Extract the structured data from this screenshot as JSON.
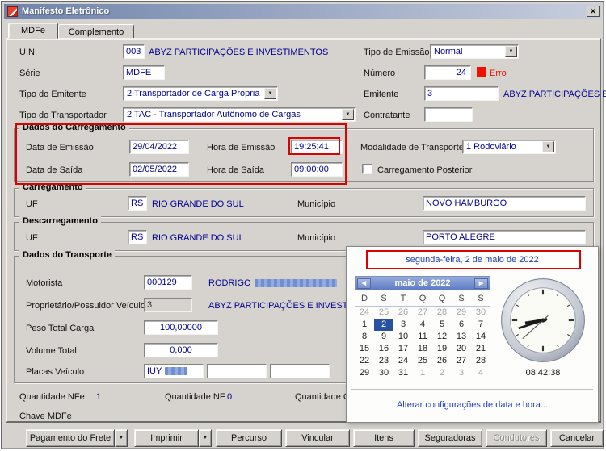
{
  "window": {
    "title": "Manifesto Eletrônico"
  },
  "glyphs": {
    "close": "✕",
    "dropdown": "▼",
    "prev": "◀",
    "next": "▶"
  },
  "tabs": {
    "mdfe": "MDFe",
    "complemento": "Complemento"
  },
  "form": {
    "un_label": "U.N.",
    "un_code": "003",
    "un_name": "ABYZ PARTICIPAÇÕES E INVESTIMENTOS",
    "tipo_emissao_label": "Tipo de Emissão",
    "tipo_emissao_value": "Normal",
    "serie_label": "Série",
    "serie_value": "MDFE",
    "numero_label": "Número",
    "numero_value": "24",
    "erro_label": "Erro",
    "tipo_emitente_label": "Tipo do Emitente",
    "tipo_emitente_value": "2 Transportador de Carga Própria",
    "emitente_label": "Emitente",
    "emitente_code": "3",
    "emitente_name": "ABYZ PARTICIPAÇÕES E INVEST",
    "tipo_transportador_label": "Tipo do Transportador",
    "tipo_transportador_value": "2 TAC - Transportador Autônomo de Cargas",
    "contratante_label": "Contratante",
    "contratante_value": ""
  },
  "dados_carregamento": {
    "title": "Dados do Carregamento",
    "data_emissao_label": "Data de Emissão",
    "data_emissao": "29/04/2022",
    "hora_emissao_label": "Hora de Emissão",
    "hora_emissao": "19:25:41",
    "modalidade_label": "Modalidade de Transporte",
    "modalidade": "1 Rodoviário",
    "data_saida_label": "Data de Saída",
    "data_saida": "02/05/2022",
    "hora_saida_label": "Hora de Saída",
    "hora_saida": "09:00:00",
    "carregamento_posterior_label": "Carregamento Posterior"
  },
  "carregamento": {
    "title": "Carregamento",
    "uf_label": "UF",
    "uf": "RS",
    "uf_nome": "RIO GRANDE DO SUL",
    "municipio_label": "Município",
    "municipio": "NOVO HAMBURGO"
  },
  "descarregamento": {
    "title": "Descarregamento",
    "uf_label": "UF",
    "uf": "RS",
    "uf_nome": "RIO GRANDE DO SUL",
    "municipio_label": "Município",
    "municipio": "PORTO ALEGRE"
  },
  "transporte": {
    "title": "Dados do Transporte",
    "motorista_label": "Motorista",
    "motorista_code": "000129",
    "motorista_nome": "RODRIGO",
    "proprietario_label": "Proprietário/Possuidor Veículo",
    "proprietario_code": "3",
    "proprietario_nome": "ABYZ PARTICIPAÇÕES E INVESTIMENTO",
    "peso_label": "Peso Total Carga",
    "peso": "100,00000",
    "volume_label": "Volume Total",
    "volume": "0,000",
    "placas_label": "Placas Veículo",
    "placa1_prefix": "IUY"
  },
  "totais": {
    "qtd_nfe_label": "Quantidade NFe",
    "qtd_nfe": "1",
    "qtd_nf_label": "Quantidade NF",
    "qtd_nf": "0",
    "qtd_c_label": "Quantidade C",
    "chave_label": "Chave MDFe"
  },
  "datetime_popup": {
    "header": "segunda-feira, 2 de maio de 2022",
    "month_title": "maio de 2022",
    "dow": [
      "D",
      "S",
      "T",
      "Q",
      "Q",
      "S",
      "S"
    ],
    "weeks": [
      [
        {
          "d": 24,
          "dim": true
        },
        {
          "d": 25,
          "dim": true
        },
        {
          "d": 26,
          "dim": true
        },
        {
          "d": 27,
          "dim": true
        },
        {
          "d": 28,
          "dim": true
        },
        {
          "d": 29,
          "dim": true
        },
        {
          "d": 30,
          "dim": true
        }
      ],
      [
        {
          "d": 1
        },
        {
          "d": 2,
          "sel": true
        },
        {
          "d": 3
        },
        {
          "d": 4
        },
        {
          "d": 5
        },
        {
          "d": 6
        },
        {
          "d": 7
        }
      ],
      [
        {
          "d": 8
        },
        {
          "d": 9
        },
        {
          "d": 10
        },
        {
          "d": 11
        },
        {
          "d": 12
        },
        {
          "d": 13
        },
        {
          "d": 14
        }
      ],
      [
        {
          "d": 15
        },
        {
          "d": 16
        },
        {
          "d": 17
        },
        {
          "d": 18
        },
        {
          "d": 19
        },
        {
          "d": 20
        },
        {
          "d": 21
        }
      ],
      [
        {
          "d": 22
        },
        {
          "d": 23
        },
        {
          "d": 24
        },
        {
          "d": 25
        },
        {
          "d": 26
        },
        {
          "d": 27
        },
        {
          "d": 28
        }
      ],
      [
        {
          "d": 29
        },
        {
          "d": 30
        },
        {
          "d": 31
        },
        {
          "d": 1,
          "dim": true
        },
        {
          "d": 2,
          "dim": true
        },
        {
          "d": 3,
          "dim": true
        },
        {
          "d": 4,
          "dim": true
        }
      ]
    ],
    "time": "08:42:38",
    "link": "Alterar configurações de data e hora..."
  },
  "buttons": {
    "pagamento_frete": "Pagamento do Frete",
    "imprimir": "Imprimir",
    "percurso": "Percurso",
    "vincular": "Vincular",
    "itens": "Itens",
    "seguradoras": "Seguradoras",
    "condutores": "Condutores",
    "cancelar": "Cancelar"
  },
  "colors": {
    "field-text": "#000090",
    "error": "#ee1100",
    "highlight": "#dd0000",
    "link": "#203cc8",
    "popup-date": "#1e3cb4",
    "selected-day-bg": "#2a50a0",
    "titlebar-start": "#6f83ab",
    "titlebar-end": "#c7cedd",
    "cal-header-start": "#94abde",
    "cal-header-end": "#5f7cc4"
  }
}
